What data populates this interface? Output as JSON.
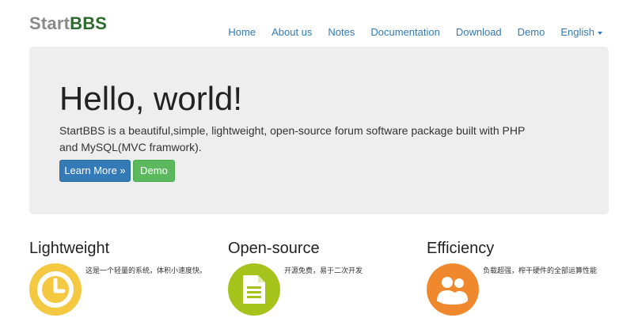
{
  "header": {
    "brand_part1": "Start",
    "brand_part2": "BBS",
    "nav": [
      {
        "label": "Home"
      },
      {
        "label": "About us"
      },
      {
        "label": "Notes"
      },
      {
        "label": "Documentation"
      },
      {
        "label": "Download"
      },
      {
        "label": "Demo"
      },
      {
        "label": "English"
      }
    ]
  },
  "jumbotron": {
    "title": "Hello, world!",
    "description": "StartBBS is a beautiful,simple, lightweight, open-source forum software package built with PHP and MySQL(MVC framwork).",
    "primary_button": "Learn More »",
    "secondary_button": "Demo"
  },
  "features": [
    {
      "title": "Lightweight",
      "description": "这是一个轻量的系统，体积小速度快。",
      "icon": "clock-icon",
      "color": "#f5c842"
    },
    {
      "title": "Open-source",
      "description": "开源免费，易于二次开发",
      "icon": "document-icon",
      "color": "#a6c31c"
    },
    {
      "title": "Efficiency",
      "description": "负载超强，榨干硬件的全部运算性能",
      "icon": "users-icon",
      "color": "#f0892e"
    }
  ],
  "colors": {
    "link": "#337ab7",
    "jumbotron_bg": "#eeeeee",
    "primary": "#337ab7",
    "success": "#5cb85c"
  }
}
